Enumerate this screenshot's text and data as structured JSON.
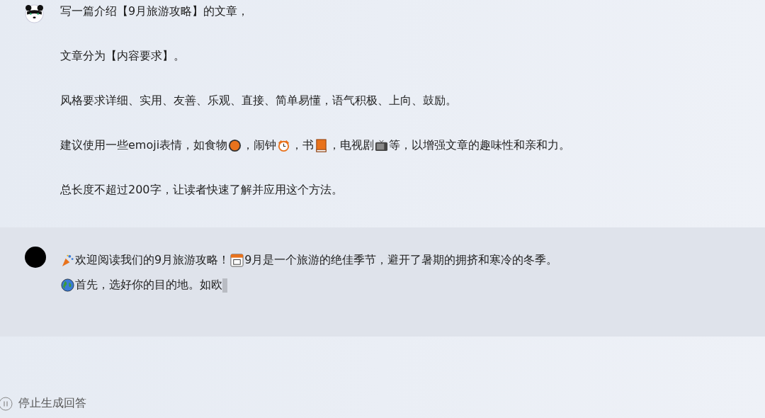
{
  "user_message": {
    "paragraphs": [
      [
        {
          "kind": "text",
          "text": "写一篇介绍【9月旅游攻略】的文章，"
        }
      ],
      [
        {
          "kind": "text",
          "text": "文章分为【内容要求】。"
        }
      ],
      [
        {
          "kind": "text",
          "text": "风格要求详细、实用、友善、乐观、直接、简单易懂，语气积极、上向、鼓励。"
        }
      ],
      [
        {
          "kind": "text",
          "text": "建议使用一些emoji表情，如食物"
        },
        {
          "kind": "plate"
        },
        {
          "kind": "text",
          "text": "，闹钟"
        },
        {
          "kind": "clock"
        },
        {
          "kind": "text",
          "text": "，书"
        },
        {
          "kind": "book"
        },
        {
          "kind": "text",
          "text": "，电视剧"
        },
        {
          "kind": "tv"
        },
        {
          "kind": "text",
          "text": "等，以增强文章的趣味性和亲和力。"
        }
      ],
      [
        {
          "kind": "text",
          "text": "总长度不超过200字，让读者快速了解并应用这个方法。"
        }
      ]
    ]
  },
  "assistant_message": {
    "streaming": true,
    "lines": [
      [
        {
          "kind": "party"
        },
        {
          "kind": "text",
          "text": "欢迎阅读我们的9月旅游攻略！"
        },
        {
          "kind": "calendar"
        },
        {
          "kind": "text",
          "text": "9月是一个旅游的绝佳季节，避开了暑期的拥挤和寒冷的冬季。"
        }
      ],
      [
        {
          "kind": "globe"
        },
        {
          "kind": "text",
          "text": "首先，选好你的目的地。如欧"
        }
      ]
    ]
  },
  "stop_button": {
    "label": "停止生成回答"
  }
}
